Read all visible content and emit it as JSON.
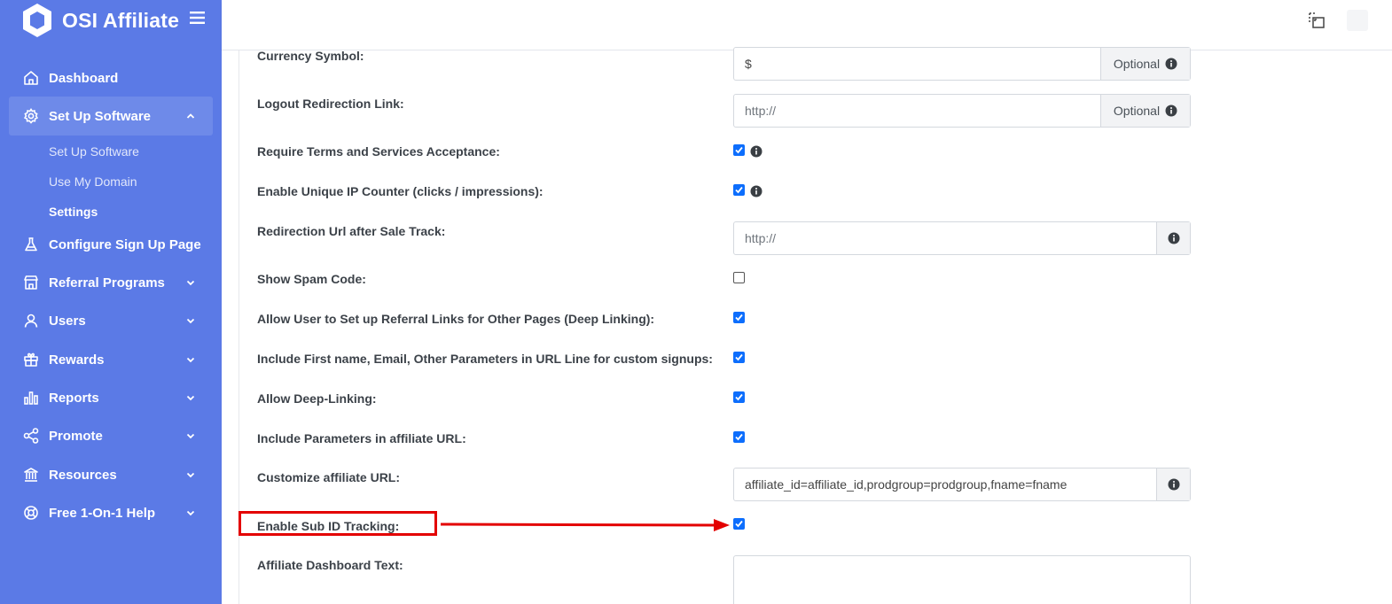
{
  "brand": {
    "name": "OSI Affiliate",
    "logo_icon": "hexagon-logo-icon",
    "menu_icon": "hamburger-icon"
  },
  "sidebar": {
    "items": [
      {
        "label": "Dashboard",
        "icon": "home-icon",
        "chevron": ""
      },
      {
        "label": "Set Up Software",
        "icon": "gear-icon",
        "chevron": "up",
        "active": true
      },
      {
        "label": "Configure Sign Up Page",
        "icon": "flask-icon",
        "chevron": ""
      },
      {
        "label": "Referral Programs",
        "icon": "store-icon",
        "chevron": "down"
      },
      {
        "label": "Users",
        "icon": "user-icon",
        "chevron": "down"
      },
      {
        "label": "Rewards",
        "icon": "gift-icon",
        "chevron": "down"
      },
      {
        "label": "Reports",
        "icon": "bar-chart-icon",
        "chevron": "down"
      },
      {
        "label": "Promote",
        "icon": "share-icon",
        "chevron": "down"
      },
      {
        "label": "Resources",
        "icon": "bank-icon",
        "chevron": "down"
      },
      {
        "label": "Free 1-On-1 Help",
        "icon": "lifebuoy-icon",
        "chevron": "down"
      }
    ],
    "sub_items": [
      {
        "label": "Set Up Software"
      },
      {
        "label": "Use My Domain"
      },
      {
        "label": "Settings",
        "current": true
      }
    ]
  },
  "topbar": {
    "icon": "fullscreen-icon"
  },
  "settings": {
    "currency_symbol": {
      "label": "Currency Symbol:",
      "value": "$",
      "addon": "Optional"
    },
    "logout_redirect": {
      "label": "Logout Redirection Link:",
      "placeholder": "http://",
      "addon": "Optional"
    },
    "require_terms": {
      "label": "Require Terms and Services Acceptance:",
      "checked": true
    },
    "unique_ip": {
      "label": "Enable Unique IP Counter (clicks / impressions):",
      "checked": true
    },
    "redirect_after_sale": {
      "label": "Redirection Url after Sale Track:",
      "placeholder": "http://"
    },
    "show_spam_code": {
      "label": "Show Spam Code:",
      "checked": false
    },
    "deep_link_other_pages": {
      "label": "Allow User to Set up Referral Links for Other Pages (Deep Linking):",
      "checked": true
    },
    "include_first_name": {
      "label": "Include First name, Email, Other Parameters in URL Line for custom signups:",
      "checked": true
    },
    "allow_deep_linking": {
      "label": "Allow Deep-Linking:",
      "checked": true
    },
    "include_params": {
      "label": "Include Parameters in affiliate URL:",
      "checked": true
    },
    "customize_url": {
      "label": "Customize affiliate URL:",
      "value": "affiliate_id=affiliate_id,prodgroup=prodgroup,fname=fname"
    },
    "sub_id_tracking": {
      "label": "Enable Sub ID Tracking:",
      "checked": true
    },
    "dashboard_text": {
      "label": "Affiliate Dashboard Text:",
      "value": ""
    }
  },
  "colors": {
    "sidebar_bg": "#5b7ae6",
    "checkbox": "#0d6efd",
    "annotation": "#e30000"
  }
}
